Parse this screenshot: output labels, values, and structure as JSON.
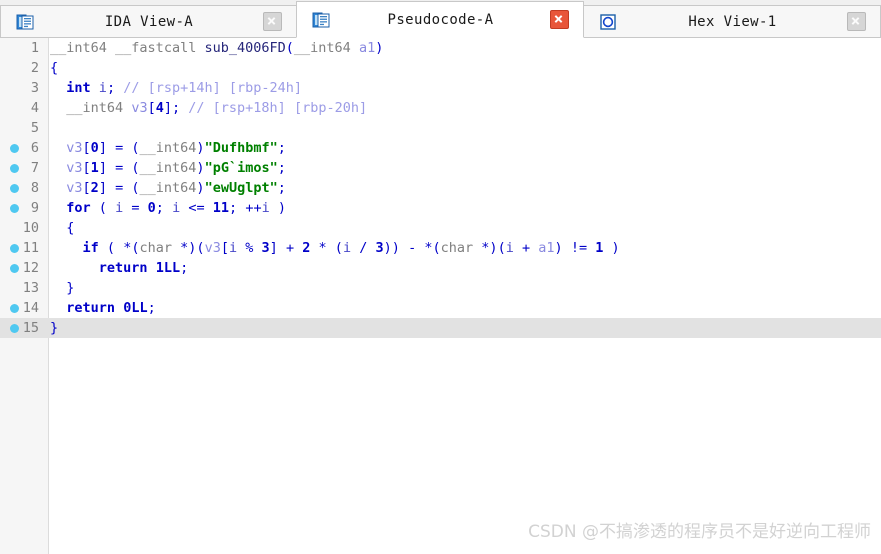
{
  "window": {
    "app": "IDA Pro - Pseudocode view"
  },
  "tabs": [
    {
      "id": "ida-view-a",
      "label": "IDA View-A",
      "icon": "document-window-icon",
      "active": false,
      "close_icon": "close-icon",
      "close_style": "gray"
    },
    {
      "id": "pseudocode-a",
      "label": "Pseudocode-A",
      "icon": "document-window-icon",
      "active": true,
      "close_icon": "close-icon",
      "close_style": "red"
    },
    {
      "id": "hex-view-1",
      "label": "Hex View-1",
      "icon": "hex-window-icon",
      "active": false,
      "close_icon": "close-icon",
      "close_style": "gray"
    }
  ],
  "colors": {
    "breakpoint_dot": "#4fc8f0",
    "string_literal": "#008000",
    "keyword": "#0000c8",
    "type": "#808080",
    "comment": "#9c9ce6",
    "variable": "#8a8ae0",
    "gutter_bg": "#f6f6f6",
    "highlight_row": "#e2e2e2",
    "close_button_active": "#e8563a",
    "watermark": "#d2d2d2"
  },
  "editor": {
    "lines": [
      {
        "n": "1",
        "marker": false,
        "highlight": false,
        "text": "__int64 __fastcall sub_4006FD(__int64 a1)"
      },
      {
        "n": "2",
        "marker": false,
        "highlight": false,
        "text": "{"
      },
      {
        "n": "3",
        "marker": false,
        "highlight": false,
        "text": "  int i; // [rsp+14h] [rbp-24h]"
      },
      {
        "n": "4",
        "marker": false,
        "highlight": false,
        "text": "  __int64 v3[4]; // [rsp+18h] [rbp-20h]"
      },
      {
        "n": "5",
        "marker": false,
        "highlight": false,
        "text": ""
      },
      {
        "n": "6",
        "marker": true,
        "highlight": false,
        "text": "  v3[0] = (__int64)\"Dufhbmf\";"
      },
      {
        "n": "7",
        "marker": true,
        "highlight": false,
        "text": "  v3[1] = (__int64)\"pG`imos\";"
      },
      {
        "n": "8",
        "marker": true,
        "highlight": false,
        "text": "  v3[2] = (__int64)\"ewUglpt\";"
      },
      {
        "n": "9",
        "marker": true,
        "highlight": false,
        "text": "  for ( i = 0; i <= 11; ++i )"
      },
      {
        "n": "10",
        "marker": false,
        "highlight": false,
        "text": "  {"
      },
      {
        "n": "11",
        "marker": true,
        "highlight": false,
        "text": "    if ( *(char *)(v3[i % 3] + 2 * (i / 3)) - *(char *)(i + a1) != 1 )"
      },
      {
        "n": "12",
        "marker": true,
        "highlight": false,
        "text": "      return 1LL;"
      },
      {
        "n": "13",
        "marker": false,
        "highlight": false,
        "text": "  }"
      },
      {
        "n": "14",
        "marker": true,
        "highlight": false,
        "text": "  return 0LL;"
      },
      {
        "n": "15",
        "marker": true,
        "highlight": true,
        "text": "}"
      }
    ]
  },
  "watermark": {
    "text": "CSDN @不搞渗透的程序员不是好逆向工程师"
  }
}
